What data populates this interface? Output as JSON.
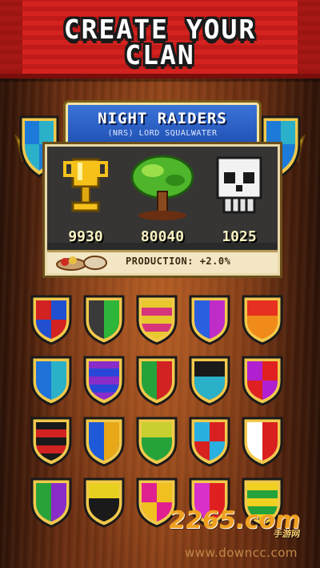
{
  "banner": {
    "line1": "CREATE YOUR",
    "line2": "CLAN"
  },
  "clan": {
    "name": "NIGHT RAIDERS",
    "subtitle": "(NRS) LORD SQUALWATER",
    "stats": [
      {
        "icon": "trophy-icon",
        "value": "9930"
      },
      {
        "icon": "tree-icon",
        "value": "80040"
      },
      {
        "icon": "skull-icon",
        "value": "1025"
      }
    ],
    "production": "PRODUCTION: +2.0%"
  },
  "watermark": {
    "brand": "2265.com",
    "sub": "手游网",
    "url": "www.downcc.com"
  },
  "shields": [
    [
      "#d22222",
      "#2050d0"
    ],
    [
      "#3a3a3a",
      "#2db63a"
    ],
    [
      "#e8c82c",
      "#d6357c"
    ],
    [
      "#2a60e0",
      "#c02cc8"
    ],
    [
      "#e63020",
      "#f08a18"
    ],
    [
      "#1e72d8",
      "#2ab0c8"
    ],
    [
      "#8a2cc8",
      "#2a46d8"
    ],
    [
      "#26a23a",
      "#d22222"
    ],
    [
      "#1a1a1a",
      "#2ab0c8"
    ],
    [
      "#b020d0",
      "#e02020"
    ],
    [
      "#1a1a1a",
      "#d22222"
    ],
    [
      "#1e5ad8",
      "#e8a818"
    ],
    [
      "#c8d030",
      "#26a23a"
    ],
    [
      "#2ab0e0",
      "#d82020"
    ],
    [
      "#ffffff",
      "#d82020"
    ],
    [
      "#2aa23a",
      "#8a2cc8"
    ],
    [
      "#e8d020",
      "#1a1a1a"
    ],
    [
      "#e02090",
      "#f0c020"
    ],
    [
      "#d830c8",
      "#e02020"
    ],
    [
      "#f0d020",
      "#26a23a"
    ]
  ]
}
